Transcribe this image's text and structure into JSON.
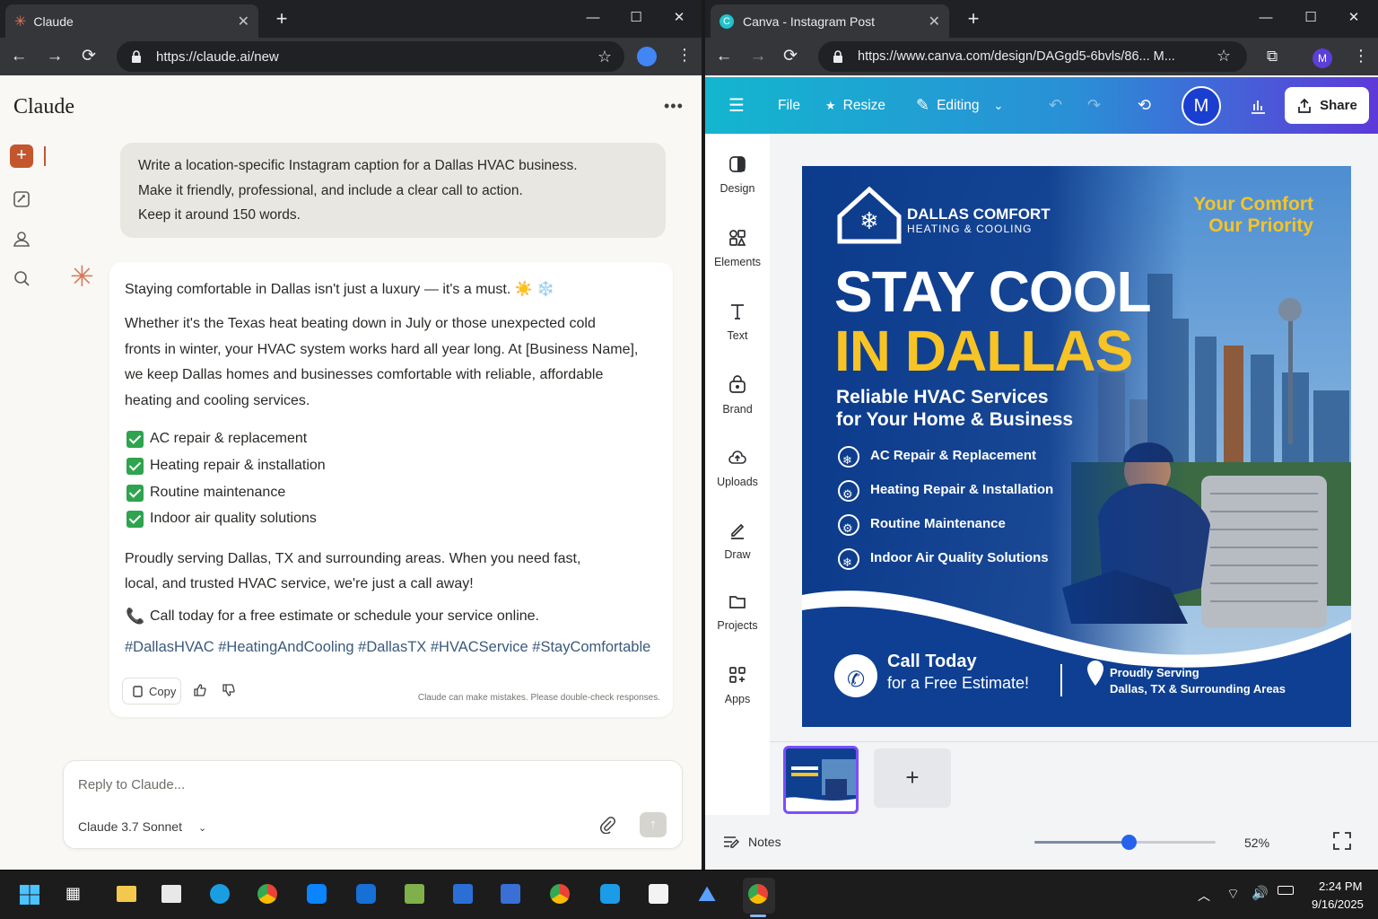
{
  "left_browser": {
    "tab_title": "Claude",
    "url": "https://claude.ai/new"
  },
  "right_browser": {
    "tab_title": "Canva - Instagram Post",
    "url": "https://www.canva.com/design/DAGgd5-6bvls/86... M..."
  },
  "claude": {
    "app_title": "Claude",
    "user_message": [
      "Write a location-specific Instagram caption for a Dallas HVAC business.",
      "Make it friendly, professional, and include a clear call to action.",
      "Keep it around 150 words."
    ],
    "response": {
      "intro": "Staying comfortable in Dallas isn't just a luxury — it's a must. ☀️ ❄️",
      "paragraph_lines": [
        "Whether it's the Texas heat beating down in July or those unexpected cold",
        "fronts in winter, your HVAC system works hard all year long. At [Business Name],",
        "we keep Dallas homes and businesses comfortable with reliable, affordable",
        "heating and cooling services."
      ],
      "checklist": [
        "AC repair & replacement",
        "Heating repair & installation",
        "Routine maintenance",
        "Indoor air quality solutions"
      ],
      "serving_lines": [
        "Proudly serving Dallas, TX and surrounding areas. When you need fast,",
        "local, and trusted HVAC service, we're just a call away!"
      ],
      "call": "Call today for a free estimate or schedule your service online.",
      "hashtags": "#DallasHVAC #HeatingAndCooling #DallasTX #HVACService #StayComfortable",
      "copy_label": "Copy",
      "disclaimer": "Claude can make mistakes. Please double-check responses."
    },
    "reply_placeholder": "Reply to Claude...",
    "model": "Claude 3.7 Sonnet"
  },
  "canva": {
    "toolbar": {
      "file": "File",
      "resize": "Resize",
      "editing": "Editing",
      "avatar": "M",
      "share": "Share"
    },
    "sidebar": [
      "Design",
      "Elements",
      "Text",
      "Brand",
      "Uploads",
      "Draw",
      "Projects",
      "Apps"
    ],
    "design": {
      "brand_line1": "DALLAS COMFORT",
      "brand_line2": "HEATING & COOLING",
      "tagline1": "Your Comfort",
      "tagline2": "Our Priority",
      "headline1": "STAY COOL",
      "headline2": "IN DALLAS",
      "sub1": "Reliable HVAC Services",
      "sub2": "for Your Home & Business",
      "services": [
        "AC Repair & Replacement",
        "Heating Repair & Installation",
        "Routine Maintenance",
        "Indoor Air Quality Solutions"
      ],
      "cta1": "Call Today",
      "cta2": "for a Free Estimate!",
      "serving1": "Proudly Serving",
      "serving2": "Dallas, TX & Surrounding Areas"
    },
    "notes": "Notes",
    "zoom": "52%",
    "zoom_fraction": 0.52
  },
  "taskbar": {
    "time": "2:24 PM",
    "date": "9/16/2025"
  },
  "colors": {
    "claude_accent": "#c4562f",
    "canva_blue": "#0f3f8f",
    "canva_yellow": "#f7c325"
  }
}
